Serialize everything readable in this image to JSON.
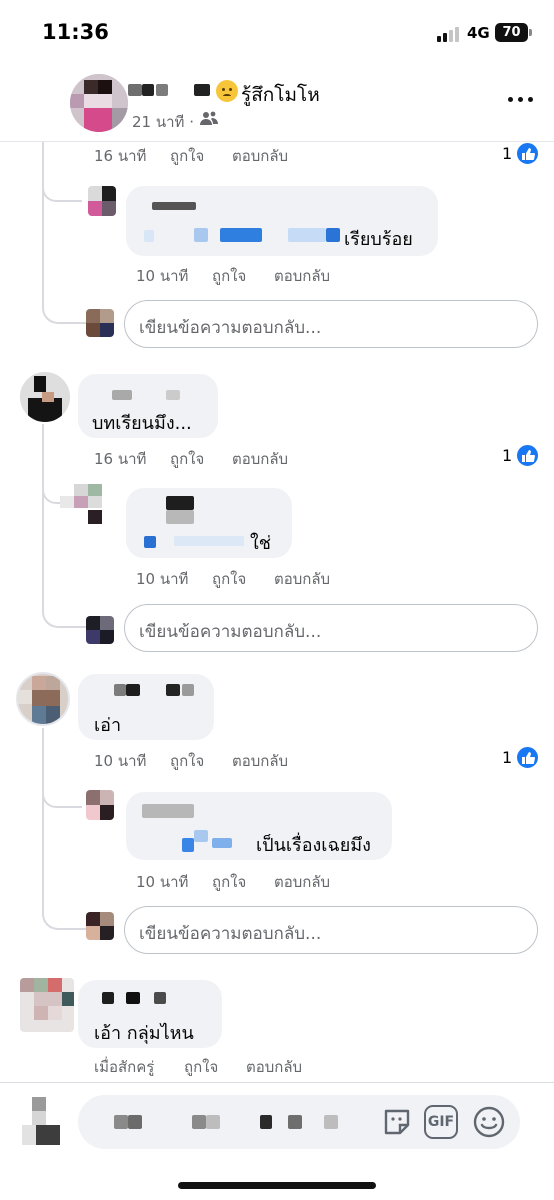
{
  "status_bar": {
    "time": "11:36",
    "network": "4G",
    "battery": "70"
  },
  "post_header": {
    "feeling": "รู้สึกโมโห",
    "time": "21 นาที",
    "separator": "·",
    "audience_icon": "friends-icon",
    "more_icon": "more-dots-icon"
  },
  "actions": {
    "like": "ถูกใจ",
    "reply": "ตอบกลับ"
  },
  "reply_placeholder": "เขียนข้อความตอบกลับ...",
  "threads": [
    {
      "comment": {
        "time": "16 นาที",
        "likes": "1"
      },
      "reply": {
        "text": "เรียบร้อย",
        "time": "10 นาที"
      }
    },
    {
      "comment": {
        "text": "บทเรียนมึง...",
        "time": "16 นาที",
        "likes": "1"
      },
      "reply": {
        "text": "ใช่",
        "time": "10 นาที"
      }
    },
    {
      "comment": {
        "text": "เอ่า",
        "time": "10 นาที",
        "likes": "1"
      },
      "reply": {
        "text": "เป็นเรื่องเฉยมึง",
        "time": "10 นาที"
      }
    },
    {
      "comment": {
        "text": "เอ้า กลุ่มไหน",
        "time": "เมื่อสักครู่"
      }
    }
  ],
  "composer": {
    "gif_label": "GIF",
    "sticker_icon": "sticker-icon",
    "emoji_icon": "smiley-icon"
  },
  "colors": {
    "like_blue": "#1877f2",
    "link_blue": "#216fdb",
    "bubble": "#f0f2f5",
    "meta_gray": "#65676b"
  }
}
